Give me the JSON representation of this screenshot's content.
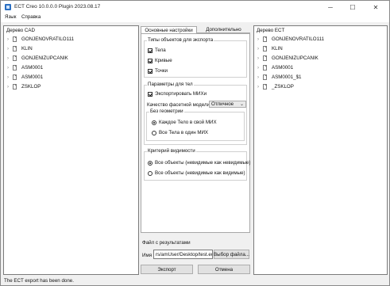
{
  "window": {
    "title": "ECT Creo 10.0.0.0 Plugin 2023.08.17",
    "minimize": "─",
    "maximize": "☐",
    "close": "✕"
  },
  "menu": [
    "Язык",
    "Справка"
  ],
  "left_panel": {
    "title": "Дерево CAD",
    "items": [
      "GONJENOVRATILO111",
      "KLIN",
      "GONJENIZUPCANIK",
      "ASM0001",
      "ASM0001",
      "ZSKLOP"
    ]
  },
  "right_panel": {
    "title": "Дерево ECT",
    "items": [
      "GONJENOVRATILO111",
      "KLIN",
      "GONJENIZUPCANIK",
      "ASM0001",
      "ASM0001_$1",
      "_ZSKLOP"
    ]
  },
  "tabs": [
    "Основные настройки",
    "Дополнительно"
  ],
  "object_types": {
    "title": "Типы объектов для экспорта",
    "items": [
      {
        "label": "Тела",
        "checked": true
      },
      {
        "label": "Кривые",
        "checked": true
      },
      {
        "label": "Точки",
        "checked": true
      }
    ]
  },
  "body_params": {
    "title": "Параметры для тел",
    "export_mixi": {
      "label": "Экспортировать МИХи",
      "checked": true
    },
    "facet_quality_label": "Качество фасетной модели",
    "facet_quality_value": "Отличное",
    "no_geometry": {
      "title": "Без геометрии",
      "options": [
        {
          "label": "Каждое Тело в свой МИХ",
          "selected": true
        },
        {
          "label": "Все Тела в один МИХ",
          "selected": false
        }
      ]
    }
  },
  "visibility": {
    "title": "Критерий видимости",
    "options": [
      {
        "label": "Все объекты (невидимые как невидимые)",
        "selected": true
      },
      {
        "label": "Все объекты (невидимые как видимые)",
        "selected": false
      }
    ]
  },
  "result_file": {
    "label": "Файл с результатами",
    "name_label": "Имя",
    "path": "rs/amUser/Desktop/test.ect",
    "choose_button": "Выбор файла..."
  },
  "buttons": {
    "export": "Экспорт",
    "cancel": "Отмена"
  },
  "status": "The ECT export has been done.",
  "icons": {
    "app": "app-icon",
    "tree_node": "document-icon",
    "expand": "chevron-right-icon"
  }
}
